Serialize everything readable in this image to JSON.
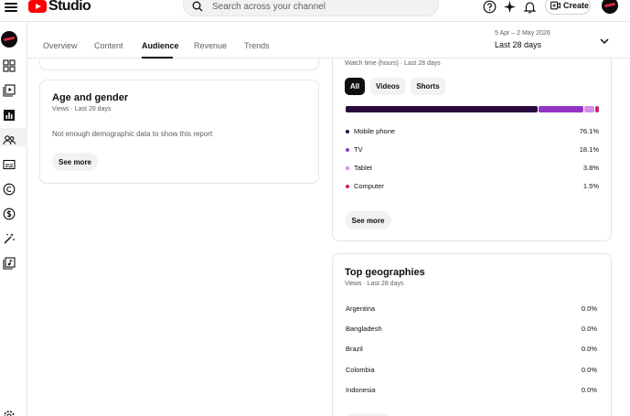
{
  "header": {
    "logo_text": "Studio",
    "search_placeholder": "Search across your channel",
    "create_label": "Create"
  },
  "tabs": [
    {
      "label": "Overview",
      "active": false
    },
    {
      "label": "Content",
      "active": false
    },
    {
      "label": "Audience",
      "active": true
    },
    {
      "label": "Revenue",
      "active": false
    },
    {
      "label": "Trends",
      "active": false
    }
  ],
  "date_selector": {
    "range": "5 Apr – 2 May 2026",
    "period": "Last 28 days"
  },
  "age_gender": {
    "title": "Age and gender",
    "subtitle": "Views · Last 28 days",
    "message": "Not enough demographic data to show this report",
    "see_more": "See more"
  },
  "device_type": {
    "subtitle": "Watch time (hours) · Last 28 days",
    "filters": [
      {
        "label": "All",
        "active": true
      },
      {
        "label": "Videos",
        "active": false
      },
      {
        "label": "Shorts",
        "active": false
      }
    ],
    "devices": [
      {
        "label": "Mobile phone",
        "value": "76.1%",
        "share": 76.1,
        "color": "#2b0a3d"
      },
      {
        "label": "TV",
        "value": "18.1%",
        "share": 18.1,
        "color": "#9334c7"
      },
      {
        "label": "Tablet",
        "value": "3.8%",
        "share": 3.8,
        "color": "#d08ee6"
      },
      {
        "label": "Computer",
        "value": "1.5%",
        "share": 1.5,
        "color": "#cc1f6b"
      }
    ],
    "see_more": "See more"
  },
  "top_geographies": {
    "title": "Top geographies",
    "subtitle": "Views · Last 28 days",
    "rows": [
      {
        "country": "Argentina",
        "value": "0.0%"
      },
      {
        "country": "Bangladesh",
        "value": "0.0%"
      },
      {
        "country": "Brazil",
        "value": "0.0%"
      },
      {
        "country": "Colombia",
        "value": "0.0%"
      },
      {
        "country": "Indonesia",
        "value": "0.0%"
      }
    ]
  },
  "icons": {
    "menu": "hamburger-icon",
    "search": "search-icon",
    "help": "help-icon",
    "sparkle": "sparkle-icon",
    "notifications": "bell-icon",
    "create": "create-video-icon",
    "collapse": "chevron-down-icon"
  }
}
